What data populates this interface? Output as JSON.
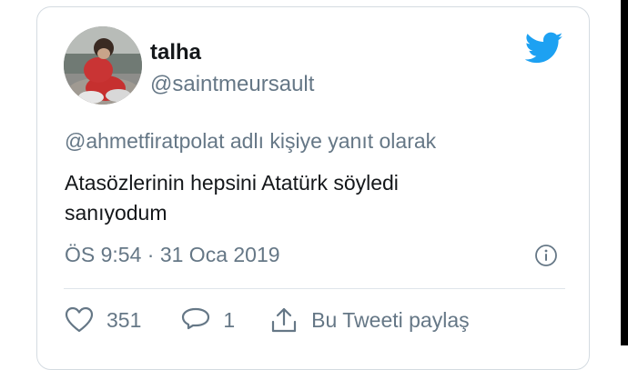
{
  "tweet": {
    "user_name": "talha",
    "user_handle": "@saintmeursault",
    "reply_context": "@ahmetfiratpolat adlı kişiye yanıt olarak",
    "text_line1": "Atasözlerinin hepsini Atatürk söyledi",
    "text_line2": "sanıyodum",
    "timestamp": "ÖS 9:54 · 31 Oca 2019",
    "likes": "351",
    "replies": "1",
    "share_label": "Bu Tweeti paylaş"
  },
  "icons": {
    "brand": "twitter-bird-icon",
    "info": "info-icon",
    "like": "heart-icon",
    "reply": "speech-bubble-icon",
    "share": "share-icon"
  },
  "colors": {
    "brand": "#1da1f2",
    "secondary_text": "#657786",
    "primary_text": "#14171a"
  }
}
